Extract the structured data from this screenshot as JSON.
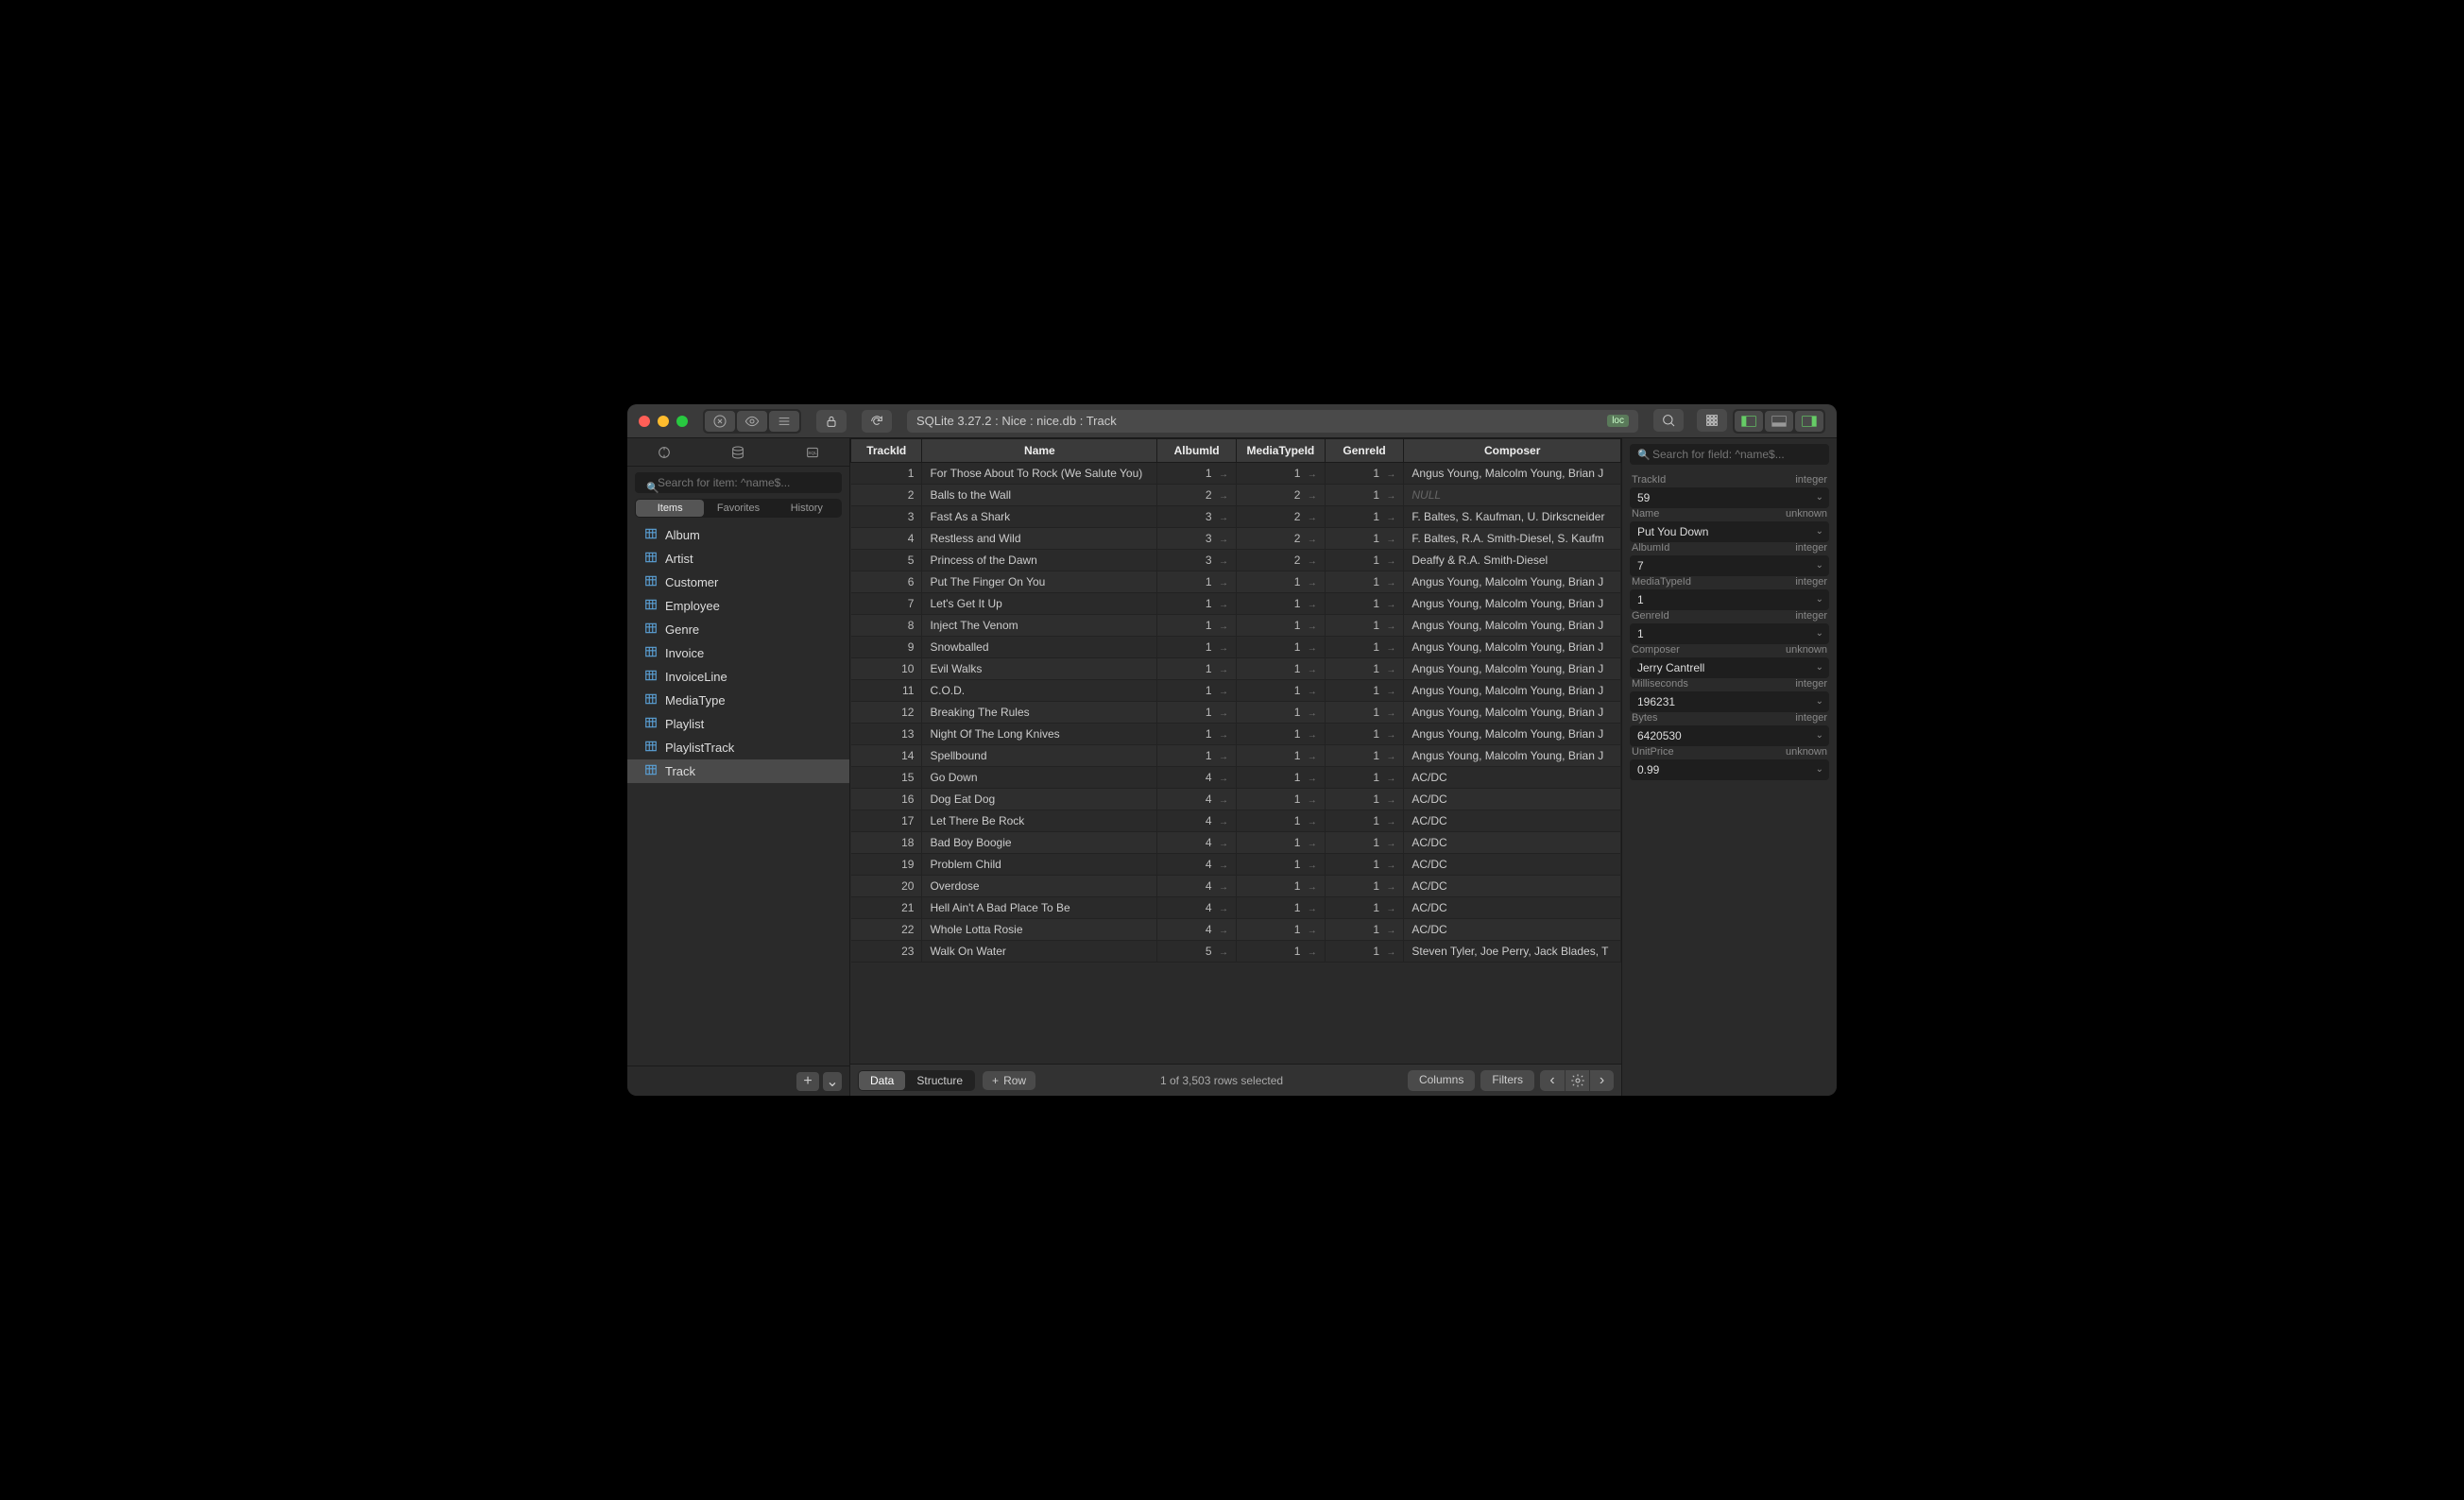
{
  "breadcrumb": "SQLite 3.27.2 : Nice : nice.db : Track",
  "breadcrumb_badge": "loc",
  "sidebar": {
    "search_placeholder": "Search for item: ^name$...",
    "tabs": [
      "Items",
      "Favorites",
      "History"
    ],
    "active_tab": 0,
    "items": [
      "Album",
      "Artist",
      "Customer",
      "Employee",
      "Genre",
      "Invoice",
      "InvoiceLine",
      "MediaType",
      "Playlist",
      "PlaylistTrack",
      "Track"
    ],
    "selected": "Track"
  },
  "columns": [
    "TrackId",
    "Name",
    "AlbumId",
    "MediaTypeId",
    "GenreId",
    "Composer"
  ],
  "rows": [
    {
      "id": "1",
      "name": "For Those About To Rock (We Salute You)",
      "album": "1",
      "media": "1",
      "genre": "1",
      "composer": "Angus Young, Malcolm Young, Brian J"
    },
    {
      "id": "2",
      "name": "Balls to the Wall",
      "album": "2",
      "media": "2",
      "genre": "1",
      "composer": null
    },
    {
      "id": "3",
      "name": "Fast As a Shark",
      "album": "3",
      "media": "2",
      "genre": "1",
      "composer": "F. Baltes, S. Kaufman, U. Dirkscneider"
    },
    {
      "id": "4",
      "name": "Restless and Wild",
      "album": "3",
      "media": "2",
      "genre": "1",
      "composer": "F. Baltes, R.A. Smith-Diesel, S. Kaufm"
    },
    {
      "id": "5",
      "name": "Princess of the Dawn",
      "album": "3",
      "media": "2",
      "genre": "1",
      "composer": "Deaffy & R.A. Smith-Diesel"
    },
    {
      "id": "6",
      "name": "Put The Finger On You",
      "album": "1",
      "media": "1",
      "genre": "1",
      "composer": "Angus Young, Malcolm Young, Brian J"
    },
    {
      "id": "7",
      "name": "Let's Get It Up",
      "album": "1",
      "media": "1",
      "genre": "1",
      "composer": "Angus Young, Malcolm Young, Brian J"
    },
    {
      "id": "8",
      "name": "Inject The Venom",
      "album": "1",
      "media": "1",
      "genre": "1",
      "composer": "Angus Young, Malcolm Young, Brian J"
    },
    {
      "id": "9",
      "name": "Snowballed",
      "album": "1",
      "media": "1",
      "genre": "1",
      "composer": "Angus Young, Malcolm Young, Brian J"
    },
    {
      "id": "10",
      "name": "Evil Walks",
      "album": "1",
      "media": "1",
      "genre": "1",
      "composer": "Angus Young, Malcolm Young, Brian J"
    },
    {
      "id": "11",
      "name": "C.O.D.",
      "album": "1",
      "media": "1",
      "genre": "1",
      "composer": "Angus Young, Malcolm Young, Brian J"
    },
    {
      "id": "12",
      "name": "Breaking The Rules",
      "album": "1",
      "media": "1",
      "genre": "1",
      "composer": "Angus Young, Malcolm Young, Brian J"
    },
    {
      "id": "13",
      "name": "Night Of The Long Knives",
      "album": "1",
      "media": "1",
      "genre": "1",
      "composer": "Angus Young, Malcolm Young, Brian J"
    },
    {
      "id": "14",
      "name": "Spellbound",
      "album": "1",
      "media": "1",
      "genre": "1",
      "composer": "Angus Young, Malcolm Young, Brian J"
    },
    {
      "id": "15",
      "name": "Go Down",
      "album": "4",
      "media": "1",
      "genre": "1",
      "composer": "AC/DC"
    },
    {
      "id": "16",
      "name": "Dog Eat Dog",
      "album": "4",
      "media": "1",
      "genre": "1",
      "composer": "AC/DC"
    },
    {
      "id": "17",
      "name": "Let There Be Rock",
      "album": "4",
      "media": "1",
      "genre": "1",
      "composer": "AC/DC"
    },
    {
      "id": "18",
      "name": "Bad Boy Boogie",
      "album": "4",
      "media": "1",
      "genre": "1",
      "composer": "AC/DC"
    },
    {
      "id": "19",
      "name": "Problem Child",
      "album": "4",
      "media": "1",
      "genre": "1",
      "composer": "AC/DC"
    },
    {
      "id": "20",
      "name": "Overdose",
      "album": "4",
      "media": "1",
      "genre": "1",
      "composer": "AC/DC"
    },
    {
      "id": "21",
      "name": "Hell Ain't A Bad Place To Be",
      "album": "4",
      "media": "1",
      "genre": "1",
      "composer": "AC/DC"
    },
    {
      "id": "22",
      "name": "Whole Lotta Rosie",
      "album": "4",
      "media": "1",
      "genre": "1",
      "composer": "AC/DC"
    },
    {
      "id": "23",
      "name": "Walk On Water",
      "album": "5",
      "media": "1",
      "genre": "1",
      "composer": "Steven Tyler, Joe Perry, Jack Blades, T"
    }
  ],
  "footer": {
    "data_label": "Data",
    "structure_label": "Structure",
    "row_label": "Row",
    "status": "1 of 3,503 rows selected",
    "columns_label": "Columns",
    "filters_label": "Filters"
  },
  "inspector": {
    "search_placeholder": "Search for field: ^name$...",
    "fields": [
      {
        "name": "TrackId",
        "type": "integer",
        "value": "59"
      },
      {
        "name": "Name",
        "type": "unknown",
        "value": "Put You Down"
      },
      {
        "name": "AlbumId",
        "type": "integer",
        "value": "7"
      },
      {
        "name": "MediaTypeId",
        "type": "integer",
        "value": "1"
      },
      {
        "name": "GenreId",
        "type": "integer",
        "value": "1"
      },
      {
        "name": "Composer",
        "type": "unknown",
        "value": "Jerry Cantrell"
      },
      {
        "name": "Milliseconds",
        "type": "integer",
        "value": "196231"
      },
      {
        "name": "Bytes",
        "type": "integer",
        "value": "6420530"
      },
      {
        "name": "UnitPrice",
        "type": "unknown",
        "value": "0.99"
      }
    ]
  },
  "null_label": "NULL"
}
